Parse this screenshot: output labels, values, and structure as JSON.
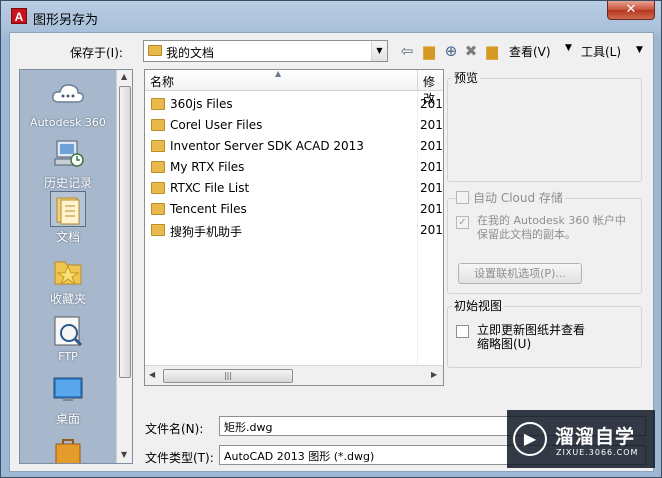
{
  "window": {
    "title": "图形另存为",
    "app_letter": "A",
    "close_glyph": "✕"
  },
  "toolbar": {
    "save_in_label": "保存于(I):",
    "save_in_value": "我的文档",
    "view_label": "查看(V)",
    "tools_label": "工具(L)"
  },
  "places": [
    {
      "label": "Autodesk 360",
      "icon": "cloud-icon"
    },
    {
      "label": "历史记录",
      "icon": "history-icon"
    },
    {
      "label": "文档",
      "icon": "documents-folder-icon"
    },
    {
      "label": "收藏夹",
      "icon": "favorites-folder-icon"
    },
    {
      "label": "FTP",
      "icon": "ftp-icon"
    },
    {
      "label": "桌面",
      "icon": "desktop-icon"
    }
  ],
  "filelist": {
    "columns": {
      "name": "名称",
      "modified": "修改"
    },
    "rows": [
      {
        "name": "360js Files",
        "date": "201"
      },
      {
        "name": "Corel User Files",
        "date": "201"
      },
      {
        "name": "Inventor Server SDK ACAD 2013",
        "date": "201"
      },
      {
        "name": "My RTX Files",
        "date": "201"
      },
      {
        "name": "RTXC File List",
        "date": "201"
      },
      {
        "name": "Tencent Files",
        "date": "201"
      },
      {
        "name": "搜狗手机助手",
        "date": "201"
      }
    ]
  },
  "preview": {
    "title": "预览"
  },
  "cloud": {
    "title": "自动 Cloud 存储",
    "option_line1": "在我的 Autodesk 360 帐户中",
    "option_line2": "保留此文档的副本。",
    "button": "设置联机选项(P)..."
  },
  "initial_view": {
    "title": "初始视图",
    "option_line1": "立即更新图纸并查看",
    "option_line2": "缩略图(U)"
  },
  "bottom": {
    "filename_label": "文件名(N):",
    "filename_value": "矩形.dwg",
    "filetype_label": "文件类型(T):",
    "filetype_value": "AutoCAD 2013 图形 (*.dwg)"
  },
  "watermark": {
    "main": "溜溜自学",
    "sub": "ZIXUE.3066.COM"
  },
  "colors": {
    "sidebar": "#a7b8cc",
    "folder": "#e9b949",
    "title_close": "#c7503a"
  }
}
